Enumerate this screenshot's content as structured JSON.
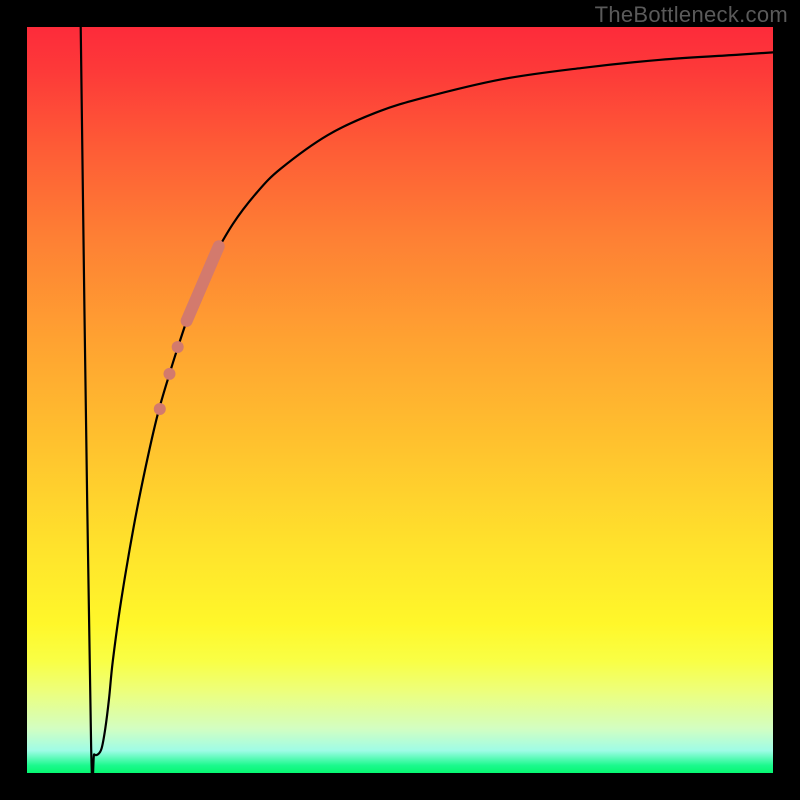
{
  "watermark": "TheBottleneck.com",
  "chart_data": {
    "type": "line",
    "title": "",
    "xlabel": "",
    "ylabel": "",
    "xlim": [
      0,
      100
    ],
    "ylim": [
      0,
      100
    ],
    "curve": {
      "x": [
        7.2,
        7.7,
        8.6,
        9.0,
        9.5,
        10.0,
        10.5,
        11.0,
        11.5,
        12.6,
        14.3,
        15.9,
        17.5,
        19.1,
        20.2,
        21.7,
        22.8,
        24.4,
        27.6,
        30.8,
        34.0,
        40.3,
        46.7,
        53.1,
        63.7,
        74.3,
        84.9,
        95.5,
        100.0
      ],
      "y": [
        100.0,
        62.0,
        3.3,
        2.5,
        2.5,
        3.3,
        6.0,
        10.0,
        15.0,
        23.0,
        33.0,
        41.0,
        48.0,
        53.5,
        57.0,
        61.5,
        64.5,
        68.0,
        73.6,
        77.8,
        81.0,
        85.5,
        88.5,
        90.5,
        93.0,
        94.5,
        95.6,
        96.3,
        96.6
      ]
    },
    "markers": {
      "stroke": {
        "x0": 21.4,
        "y0": 60.6,
        "x1": 25.7,
        "y1": 70.6
      },
      "dots": [
        {
          "x": 20.2,
          "y": 57.1
        },
        {
          "x": 19.1,
          "y": 53.5
        },
        {
          "x": 17.8,
          "y": 48.8
        }
      ]
    },
    "background_gradient": {
      "top": "#fd2b3a",
      "mid": "#ffe32c",
      "bottom": "#06f771"
    }
  }
}
